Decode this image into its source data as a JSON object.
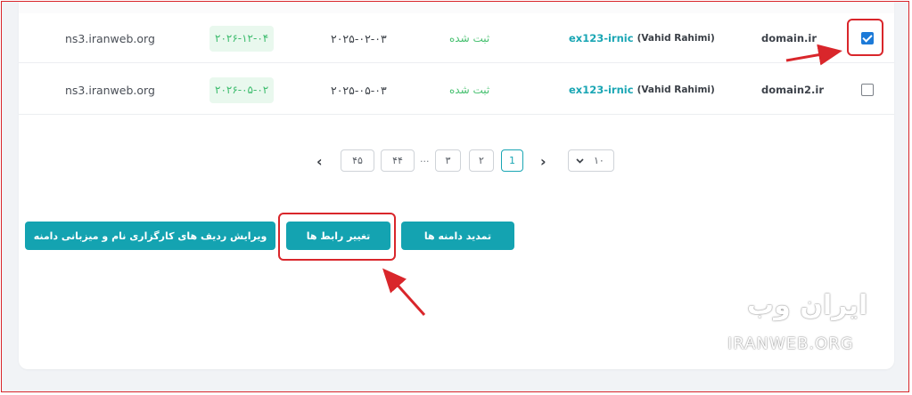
{
  "table": {
    "rows": [
      {
        "nameserver": "ns3.iranweb.org",
        "expiry": "۲۰۲۶-۱۲-۰۴",
        "registered": "۲۰۲۵-۰۲-۰۳",
        "status": "ثبت شده",
        "owner_handle": "ex123-irnic",
        "owner_name": "(Vahid Rahimi)",
        "domain": "domain.ir",
        "checked": true
      },
      {
        "nameserver": "ns3.iranweb.org",
        "expiry": "۲۰۲۶-۰۵-۰۲",
        "registered": "۲۰۲۵-۰۵-۰۳",
        "status": "ثبت شده",
        "owner_handle": "ex123-irnic",
        "owner_name": "(Vahid Rahimi)",
        "domain": "domain2.ir",
        "checked": false
      }
    ]
  },
  "pagination": {
    "pages": [
      "۴۵",
      "۴۴",
      "...",
      "۳",
      "۲",
      "1"
    ],
    "active_page": "1",
    "page_size": "۱۰",
    "prev_icon": "chevron-left-icon",
    "next_icon": "chevron-right-icon",
    "dropdown_icon": "chevron-down-icon"
  },
  "actions": {
    "edit_glue": "ویرایش ردیف های کارگزاری نام و میزبانی دامنه",
    "change_ns": "تغییر رابط ها",
    "renew": "تمدید دامنه ها"
  },
  "watermark": {
    "fa": "ایران وب",
    "en": "IRANWEB.ORG"
  },
  "colors": {
    "accent": "#14a3b1",
    "highlight": "#d9262b",
    "status_green": "#46c06f"
  }
}
